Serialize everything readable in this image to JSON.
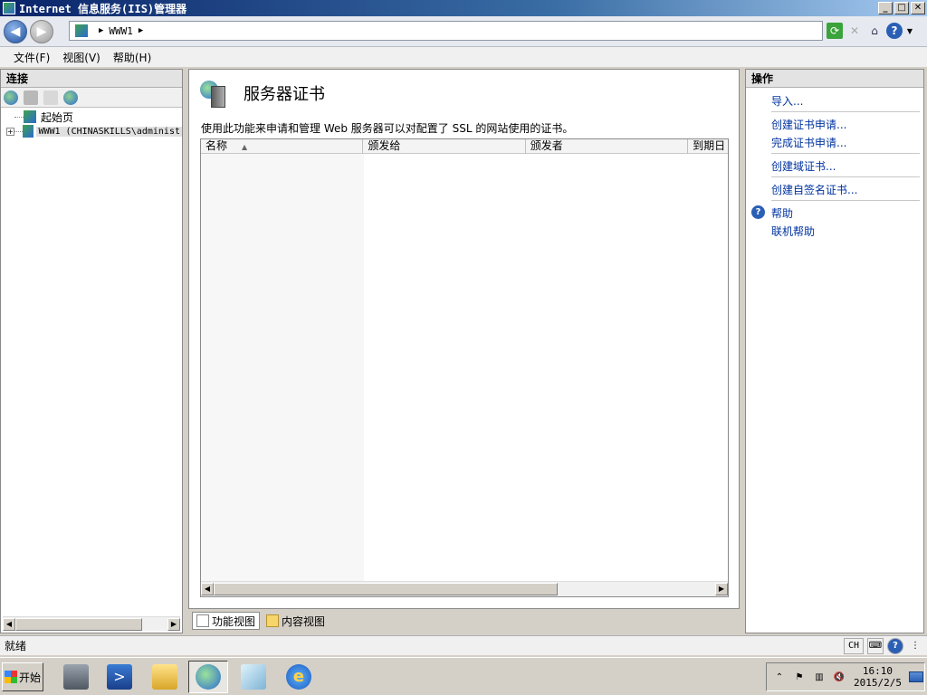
{
  "window": {
    "title": "Internet 信息服务(IIS)管理器",
    "buttons": [
      "_",
      "□",
      "✕"
    ]
  },
  "address": {
    "segments": [
      "WWW1"
    ],
    "separator": "▶"
  },
  "menu": {
    "items": [
      "文件(F)",
      "视图(V)",
      "帮助(H)"
    ]
  },
  "connections": {
    "header": "连接",
    "tree": [
      {
        "label": "起始页",
        "expandable": false,
        "selected": false
      },
      {
        "label": "WWW1 (CHINASKILLS\\administ",
        "expandable": true,
        "selected": true
      }
    ]
  },
  "center": {
    "title": "服务器证书",
    "description": "使用此功能来申请和管理 Web 服务器可以对配置了 SSL 的网站使用的证书。",
    "columns": [
      "名称",
      "颁发给",
      "颁发者",
      "到期日"
    ],
    "rows": [],
    "view_tabs": [
      "功能视图",
      "内容视图"
    ]
  },
  "actions": {
    "header": "操作",
    "groups": [
      [
        "导入..."
      ],
      [
        "创建证书申请...",
        "完成证书申请..."
      ],
      [
        "创建域证书..."
      ],
      [
        "创建自签名证书..."
      ]
    ],
    "help": [
      "帮助",
      "联机帮助"
    ]
  },
  "status": {
    "text": "就绪",
    "language": "CH"
  },
  "taskbar": {
    "start_label": "开始",
    "time": "16:10",
    "date": "2015/2/5"
  },
  "colors": {
    "title_gradient_start": "#0a246a",
    "link": "#0033a0",
    "selection": "#e0e0e0"
  }
}
